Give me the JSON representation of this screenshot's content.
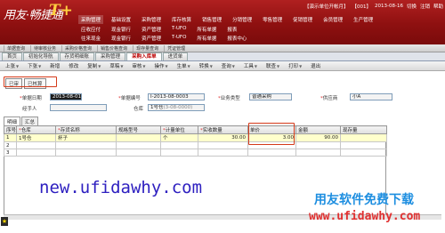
{
  "header": {
    "logo_text": "用友·畅捷通",
    "logo_mark": "T+",
    "top_right": {
      "account": "【演示单位开帐月】",
      "user": "【001】",
      "date": "2013-08-16",
      "links": [
        "切换",
        "注销",
        "帮助"
      ]
    },
    "nav_row1": [
      "采购管理",
      "基础设置",
      "采购管理",
      "库存核算",
      "销售管理",
      "分销管理",
      "零售管理",
      "促销管理",
      "会员管理",
      "生产管理"
    ],
    "nav_row2": [
      "应收应付",
      "现金银行",
      "资产管理",
      "T-UFO",
      "所有单据",
      "报表"
    ],
    "nav_row3": [
      "往来现金",
      "现金银行",
      "资产管理",
      "T-UFO",
      "所有单据",
      "报表中心"
    ]
  },
  "subnav": [
    "单据查询",
    "待审核业务",
    "采购价格查询",
    "销售价格查询",
    "现存量查询",
    "凭证管理"
  ],
  "tabs": [
    "首页",
    "初始化导航",
    "存货明细账",
    "采购管理",
    "采购入库单",
    "进货单"
  ],
  "toolbar": {
    "items": [
      "上张",
      "下张",
      "新增",
      "修改",
      "复制",
      "草稿",
      "审核",
      "操作",
      "生单",
      "转换",
      "查询",
      "工具",
      "联查",
      "打印",
      "退出"
    ]
  },
  "status_buttons": [
    "已审",
    "已核算"
  ],
  "form": {
    "date_label": "单据日期",
    "date_value": "2013-08-01",
    "code_label": "单据编号",
    "code_value": "I-2013-08-0003",
    "biztype_label": "业务类型",
    "biztype_value": "普通采购",
    "supplier_label": "供应商",
    "supplier_value": "小A",
    "handler_label": "经手人",
    "handler_value": "",
    "warehouse_label": "仓库",
    "warehouse_value": "1号仓",
    "warehouse_hint": "(3-08-0000)"
  },
  "detail_tabs": [
    "明细",
    "汇总"
  ],
  "table": {
    "headers": [
      "序号",
      "仓库",
      "存货名称",
      "规格型号",
      "计量单位",
      "实收数量",
      "单价",
      "金额",
      "现存量"
    ],
    "rows": [
      [
        "1",
        "1号仓",
        "杯子",
        "",
        "个",
        "30.00",
        "3.00",
        "90.00",
        ""
      ],
      [
        "2",
        "",
        "",
        "",
        "",
        "",
        "",
        "",
        ""
      ],
      [
        "3",
        "",
        "",
        "",
        "",
        "",
        "",
        "",
        ""
      ]
    ]
  },
  "watermark": {
    "url_left": "new.ufidawhy.com",
    "title_right": "用友软件免费下载",
    "url_right": "www.ufidawhy.com"
  }
}
